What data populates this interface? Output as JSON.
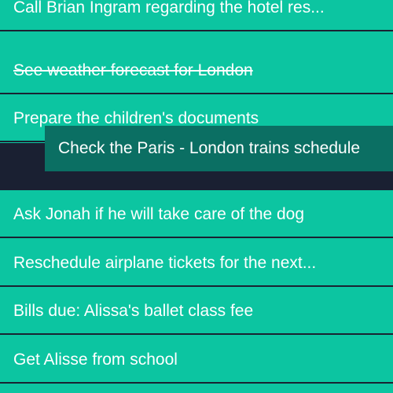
{
  "todos": [
    {
      "label": "Call Brian Ingram regarding the hotel res...",
      "completed": false
    },
    {
      "label": "See weather forecast for London",
      "completed": true
    },
    {
      "label": "Prepare the children's documents",
      "completed": false
    },
    {
      "label": "Ask Jonah if he will take care of the dog",
      "completed": false
    },
    {
      "label": "Reschedule airplane tickets for the next...",
      "completed": false
    },
    {
      "label": "Bills due: Alissa's ballet class fee",
      "completed": false
    },
    {
      "label": "Get Alisse from school",
      "completed": false
    }
  ],
  "dragging_item": {
    "label": "Check the Paris - London trains schedule"
  },
  "colors": {
    "row_background": "#0cc5a1",
    "divider": "#1a2332",
    "drop_gap": "#1a2032",
    "dragging_background": "#0b6f63",
    "text": "#ffffff"
  }
}
